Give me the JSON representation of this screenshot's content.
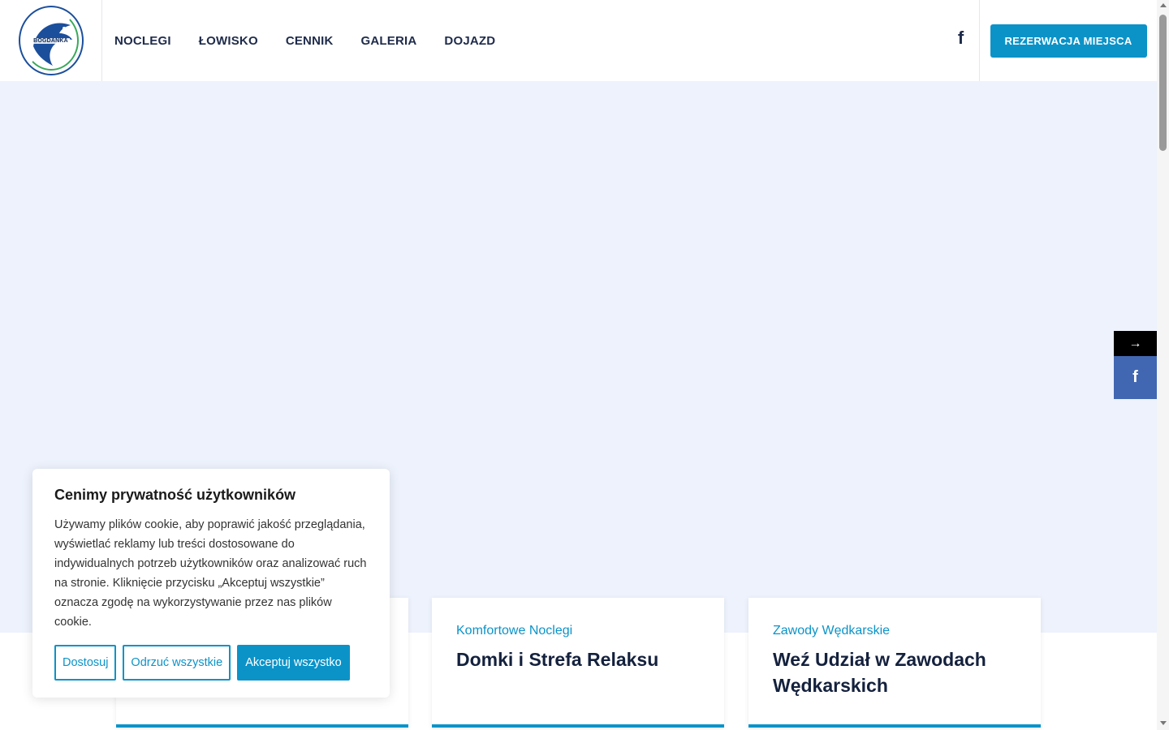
{
  "header": {
    "logo_text": "BOGDANKA",
    "nav": [
      {
        "label": "NOCLEGI"
      },
      {
        "label": "ŁOWISKO"
      },
      {
        "label": "CENNIK"
      },
      {
        "label": "GALERIA"
      },
      {
        "label": "DOJAZD"
      }
    ],
    "facebook_icon": "f",
    "reserve_label": "REZERWACJA MIEJSCA"
  },
  "side": {
    "arrow_icon": "→",
    "facebook_icon": "f"
  },
  "cards": [
    {
      "subtitle": "Komfortowe Noclegi",
      "title": "Domki i Strefa Relaksu"
    },
    {
      "subtitle": "Zawody Wędkarskie",
      "title": "Weź Udział w Zawodach Wędkarskich"
    }
  ],
  "cookie": {
    "title": "Cenimy prywatność użytkowników",
    "text": "Używamy plików cookie, aby poprawić jakość przeglądania, wyświetlać reklamy lub treści dostosowane do indywidualnych potrzeb użytkowników oraz analizować ruch na stronie. Kliknięcie przycisku „Akceptuj wszystkie” oznacza zgodę na wykorzystywanie przez nas plików cookie.",
    "customize_label": "Dostosuj",
    "reject_label": "Odrzuć wszystkie",
    "accept_label": "Akceptuj wszystko"
  },
  "colors": {
    "accent": "#0b93c8",
    "nav_text": "#1e2b4a",
    "hero_bg": "#edf2fc",
    "facebook_blue": "#4267b2"
  }
}
